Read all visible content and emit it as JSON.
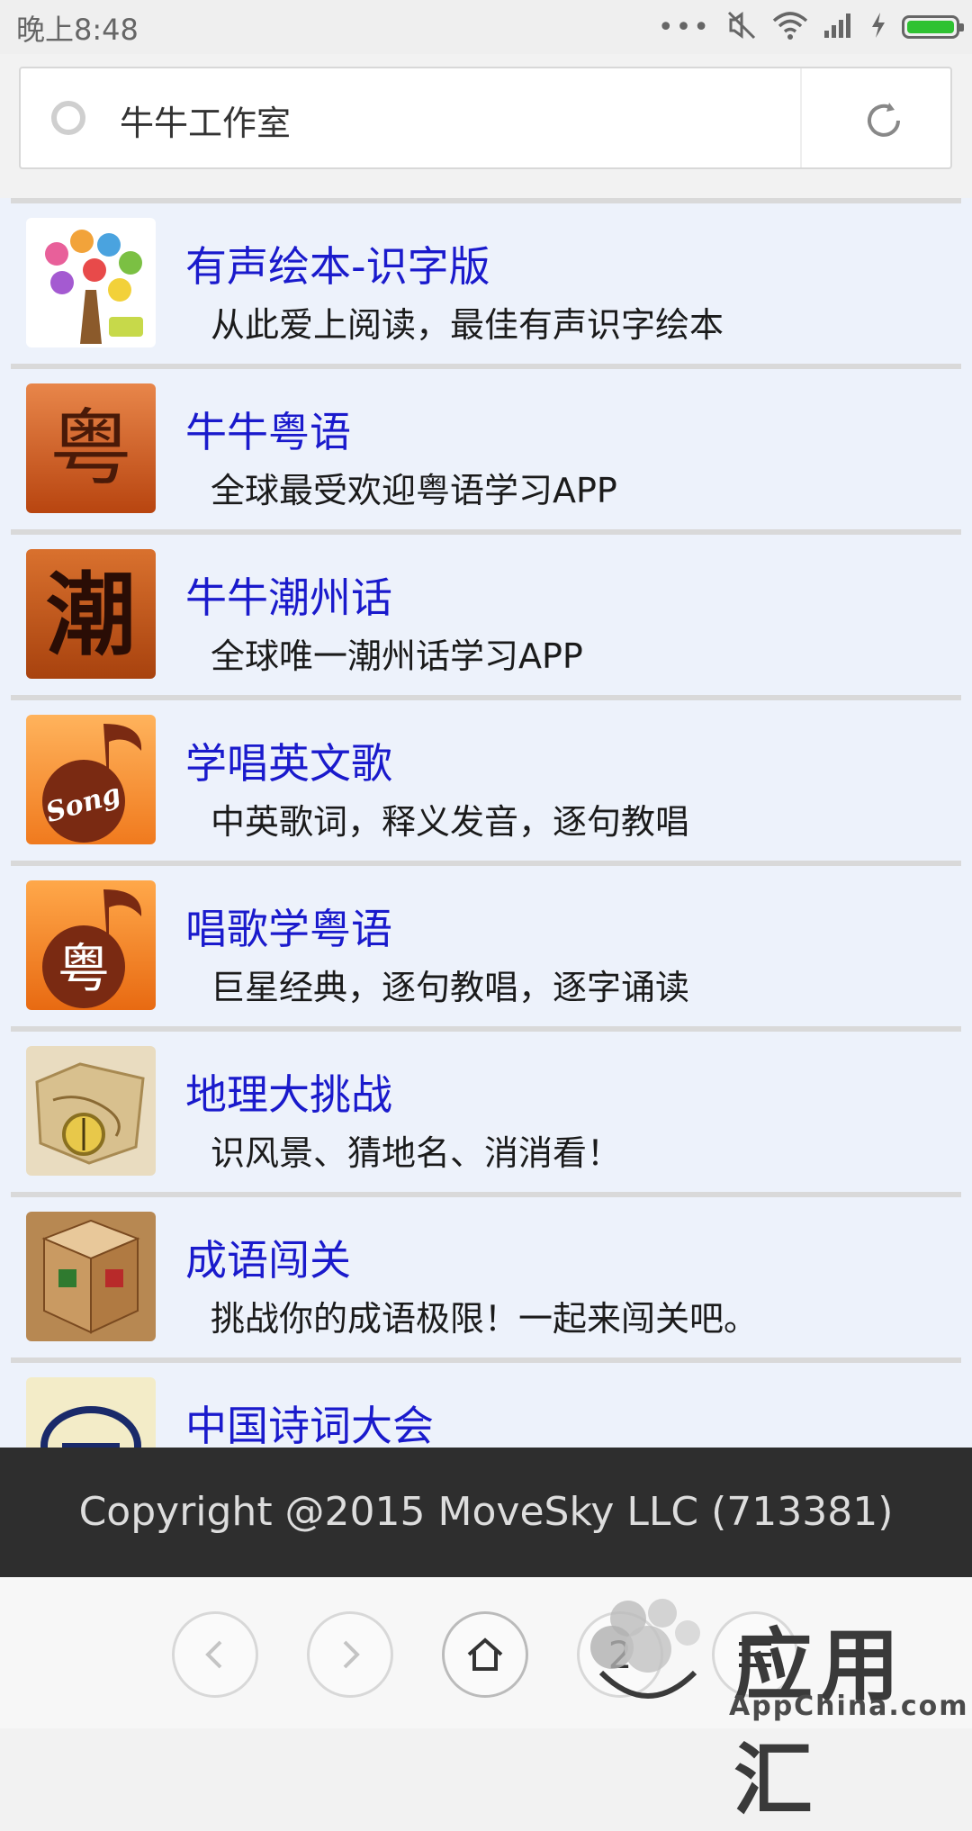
{
  "status_bar": {
    "time": "晚上8:48",
    "icons": [
      "more-dots-icon",
      "mute-icon",
      "wifi-icon",
      "signal-icon",
      "charging-icon",
      "battery-icon"
    ]
  },
  "address_bar": {
    "title": "牛牛工作室",
    "site_icon": "site-icon",
    "reload_icon": "reload-icon"
  },
  "apps": [
    {
      "title": "有声绘本-识字版",
      "subtitle": "从此爱上阅读，最佳有声识字绘本"
    },
    {
      "title": "牛牛粤语",
      "subtitle": "全球最受欢迎粤语学习APP"
    },
    {
      "title": "牛牛潮州话",
      "subtitle": "全球唯一潮州话学习APP"
    },
    {
      "title": "学唱英文歌",
      "subtitle": "中英歌词，释义发音，逐句教唱"
    },
    {
      "title": "唱歌学粤语",
      "subtitle": "巨星经典，逐句教唱，逐字诵读"
    },
    {
      "title": "地理大挑战",
      "subtitle": "识风景、猜地名、消消看！"
    },
    {
      "title": "成语闯关",
      "subtitle": "挑战你的成语极限！一起来闯关吧。"
    },
    {
      "title": "中国诗词大会",
      "subtitle": ""
    }
  ],
  "icon_glyphs": {
    "cantonese": "粤",
    "chaozhou": "潮",
    "song": "Song",
    "song_cantonese": "粤"
  },
  "footer": {
    "copyright": "Copyright @2015 MoveSky LLC (713381)"
  },
  "bottom_nav": {
    "tab_count": "2"
  },
  "watermark": {
    "text": "应用汇",
    "sub": "AppChina.com"
  }
}
